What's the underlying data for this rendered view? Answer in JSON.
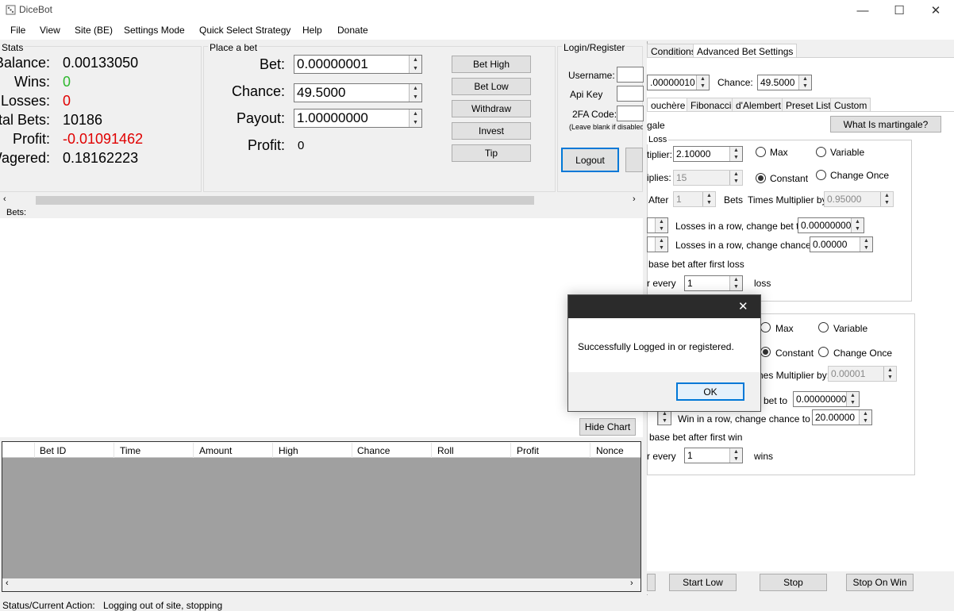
{
  "window": {
    "title": "DiceBot"
  },
  "menu": [
    "File",
    "View",
    "Site (BE)",
    "Settings Mode",
    "Quick Select Strategy",
    "Help",
    "Donate"
  ],
  "stats": {
    "group_label": "Stats",
    "rows": [
      {
        "label": "Balance:",
        "value": "0.00133050",
        "color": "#000000"
      },
      {
        "label": "Wins:",
        "value": "0",
        "color": "#2db82d"
      },
      {
        "label": "Losses:",
        "value": "0",
        "color": "#e00000"
      },
      {
        "label": "Total Bets:",
        "value": "10186",
        "color": "#000000"
      },
      {
        "label": "Profit:",
        "value": "-0.01091462",
        "color": "#e00000"
      },
      {
        "label": "Wagered:",
        "value": "0.18162223",
        "color": "#000000"
      }
    ]
  },
  "place_bet": {
    "group_label": "Place a bet",
    "bet_label": "Bet:",
    "bet_value": "0.00000001",
    "chance_label": "Chance:",
    "chance_value": "49.5000",
    "payout_label": "Payout:",
    "payout_value": "1.00000000",
    "profit_label": "Profit:",
    "profit_value": "0",
    "buttons": [
      "Bet High",
      "Bet Low",
      "Withdraw",
      "Invest",
      "Tip"
    ]
  },
  "login": {
    "group_label": "Login/Register",
    "username_label": "Username:",
    "apikey_label": "Api Key",
    "twofa_label": "2FA Code:",
    "twofa_hint": "(Leave blank if disabled)",
    "logout_button": "Logout"
  },
  "bets_label": "Bets:",
  "hide_chart_button": "Hide Chart",
  "table": {
    "columns": [
      "Bet ID",
      "Time",
      "Amount",
      "High",
      "Chance",
      "Roll",
      "Profit",
      "Nonce"
    ]
  },
  "status": {
    "label": "Status/Current Action:",
    "value": "Logging out of site, stopping"
  },
  "right": {
    "top_tabs": [
      "Conditions",
      "Advanced Bet Settings"
    ],
    "base_value": ".00000010",
    "chance_label": "Chance:",
    "chance_value": "49.5000",
    "strategy_tabs": [
      "ouchère",
      "Fibonacci",
      "d'Alembert",
      "Preset List",
      "Custom"
    ],
    "strategy_name": "gale",
    "what_button": "What Is martingale?",
    "loss_group": "Loss",
    "multiplier_label": "tiplier:",
    "multiplier_value": "2.10000",
    "max_label": "Max",
    "variable_label": "Variable",
    "multiplies_label": "iplies:",
    "multiplies_value": "15",
    "constant_label": "Constant",
    "change_once_label": "Change Once",
    "after_label": "After",
    "after_value": "1",
    "bets_label": "Bets",
    "times_mult_label": "Times Multiplier by:",
    "times_mult_value": "0.95000",
    "loss_row_bet_label": "Losses in a row, change bet to",
    "loss_row_bet_value": "0.00000000",
    "loss_row_chance_label": "Losses in a row, change chance to",
    "loss_row_chance_value": "0.00000",
    "base_after_loss": "base bet after first loss",
    "every_label": "r every",
    "every_loss_value": "1",
    "loss_word": "loss",
    "win_max_label": "Max",
    "win_variable_label": "Variable",
    "win_constant_label": "Constant",
    "win_change_once_label": "Change Once",
    "win_times_mult_label": "nes Multiplier by:",
    "win_times_mult_value": "0.00001",
    "win_bet_label": "bet to",
    "win_bet_value": "0.00000000",
    "win_chance_label": "Win in a row, change chance to",
    "win_chance_value": "20.00000",
    "base_after_win": "base bet after first win",
    "win_every_label": "r every",
    "every_win_value": "1",
    "wins_word": "wins",
    "bottom_buttons": [
      "Start Low",
      "Stop",
      "Stop On Win"
    ]
  },
  "dialog": {
    "message": "Successfully Logged in or registered.",
    "ok_button": "OK"
  }
}
